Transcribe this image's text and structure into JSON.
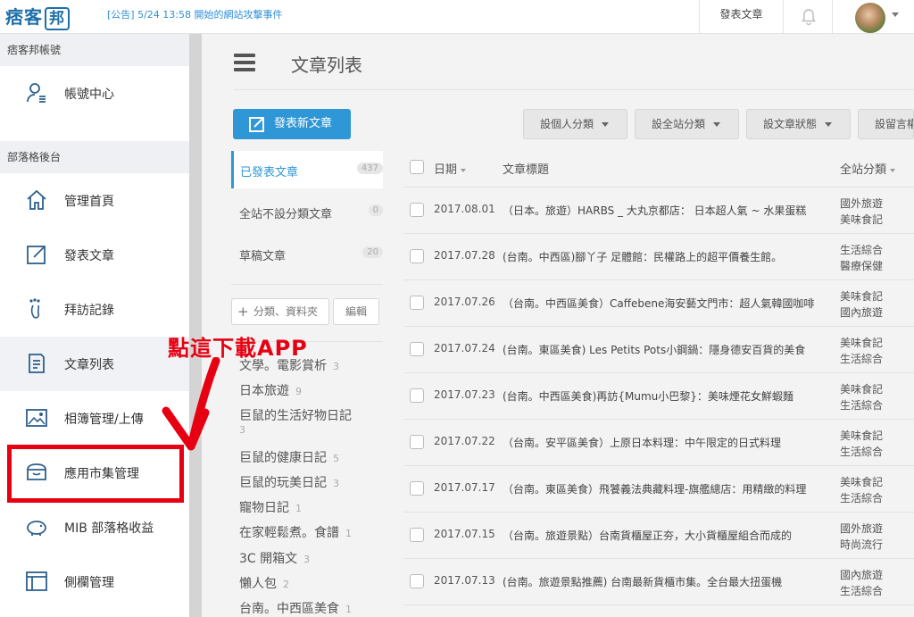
{
  "topbar": {
    "logo_text": "痞客",
    "logo_mark": "邦",
    "notice": "[公告] 5/24 13:58 開始的網站攻擊事件",
    "publish_label": "發表文章",
    "bell_icon": "bell-icon"
  },
  "sidebar": {
    "section_account": "痞客邦帳號",
    "section_blog": "部落格後台",
    "items": [
      {
        "label": "帳號中心",
        "icon": "account-icon"
      },
      {
        "label": "管理首頁",
        "icon": "home-icon"
      },
      {
        "label": "發表文章",
        "icon": "edit-icon"
      },
      {
        "label": "拜訪記錄",
        "icon": "footprint-icon"
      },
      {
        "label": "文章列表",
        "icon": "article-list-icon"
      },
      {
        "label": "相簿管理/上傳",
        "icon": "album-icon"
      },
      {
        "label": "應用市集管理",
        "icon": "app-store-icon"
      },
      {
        "label": "MIB 部落格收益",
        "icon": "piggy-bank-icon"
      },
      {
        "label": "側欄管理",
        "icon": "sidebar-layout-icon"
      }
    ]
  },
  "main": {
    "title": "文章列表",
    "new_post_label": "發表新文章",
    "filters": [
      "設個人分類",
      "設全站分類",
      "設文章狀態",
      "設留言權"
    ],
    "categories": [
      {
        "label": "已發表文章",
        "count": "437"
      },
      {
        "label": "全站不設分類文章",
        "count": "0"
      },
      {
        "label": "草稿文章",
        "count": "20"
      }
    ],
    "add_category_label": "分類、資料夾",
    "edit_category_label": "編輯",
    "folders": [
      {
        "label": "文學。電影賞析",
        "count": "3"
      },
      {
        "label": "日本旅遊",
        "count": "9"
      },
      {
        "label": "巨鼠的生活好物日記",
        "count": "3"
      },
      {
        "label": "巨鼠的健康日記",
        "count": "5"
      },
      {
        "label": "巨鼠的玩美日記",
        "count": "3"
      },
      {
        "label": "寵物日記",
        "count": "1"
      },
      {
        "label": "在家輕鬆煮。食譜",
        "count": "1"
      },
      {
        "label": "3C 開箱文",
        "count": "3"
      },
      {
        "label": "懶人包",
        "count": "2"
      },
      {
        "label": "台南。中西區美食",
        "count": "1"
      }
    ],
    "table": {
      "col_date": "日期",
      "col_title": "文章標題",
      "col_category": "全站分類",
      "rows": [
        {
          "date": "2017.08.01",
          "title": "（日本。旅遊）HARBS _ 大丸京都店： 日本超人氣 ~ 水果蛋糕",
          "cat1": "國外旅遊",
          "cat2": "美味食記"
        },
        {
          "date": "2017.07.28",
          "title": "(台南。中西區)腳丫子 足體館：民權路上的超平價養生館。",
          "cat1": "生活綜合",
          "cat2": "醫療保健"
        },
        {
          "date": "2017.07.26",
          "title": "（台南。中西區美食）Caffebene海安藝文門市：超人氣韓國咖啡",
          "cat1": "美味食記",
          "cat2": "國內旅遊"
        },
        {
          "date": "2017.07.24",
          "title": "(台南。東區美食) Les Petits Pots小鋼鍋：隱身德安百貨的美食",
          "cat1": "美味食記",
          "cat2": "生活綜合"
        },
        {
          "date": "2017.07.23",
          "title": "(台南。中西區美食)再訪{Mumu小巴黎}：美味煙花女鮮蝦麵",
          "cat1": "美味食記",
          "cat2": "生活綜合"
        },
        {
          "date": "2017.07.22",
          "title": "（台南。安平區美食）上原日本料理：中午限定的日式料理",
          "cat1": "美味食記",
          "cat2": "生活綜合"
        },
        {
          "date": "2017.07.17",
          "title": "（台南。東區美食）飛饕義法典藏料理-旗艦總店：用精緻的料理",
          "cat1": "美味食記",
          "cat2": "生活綜合"
        },
        {
          "date": "2017.07.15",
          "title": "（台南。旅遊景點）台南貨櫃屋正夯，大小貨櫃屋組合而成的",
          "cat1": "國外旅遊",
          "cat2": "時尚流行"
        },
        {
          "date": "2017.07.13",
          "title": "(台南。旅遊景點推薦) 台南最新貨櫃市集。全台最大扭蛋機",
          "cat1": "國內旅遊",
          "cat2": "生活綜合"
        }
      ]
    }
  },
  "annotation": {
    "text": "點這下載APP",
    "color": "#e60012"
  },
  "colors": {
    "accent": "#2f97d6",
    "highlight": "#e60012"
  }
}
